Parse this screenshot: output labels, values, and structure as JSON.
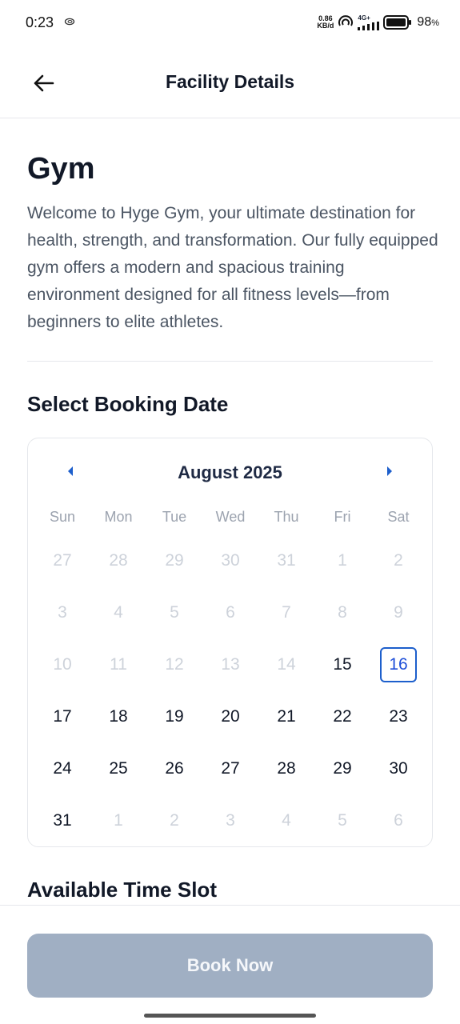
{
  "status_bar": {
    "time": "0:23",
    "net_speed_value": "0.86",
    "net_speed_unit": "KB/d",
    "network_type": "4G+",
    "battery_percent": "98",
    "battery_unit": "%"
  },
  "header": {
    "title": "Facility Details",
    "back_icon": "arrow-left-icon"
  },
  "facility": {
    "name": "Gym",
    "description": "Welcome to Hyge Gym, your ultimate destination for health, strength, and transformation. Our fully equipped gym offers a modern and spacious training environment designed for all fitness levels—from beginners to elite athletes."
  },
  "booking": {
    "section_title": "Select Booking Date",
    "calendar": {
      "month_label": "August 2025",
      "prev_icon": "caret-left-icon",
      "next_icon": "caret-right-icon",
      "weekdays": [
        "Sun",
        "Mon",
        "Tue",
        "Wed",
        "Thu",
        "Fri",
        "Sat"
      ],
      "days": [
        {
          "label": "27",
          "state": "muted"
        },
        {
          "label": "28",
          "state": "muted"
        },
        {
          "label": "29",
          "state": "muted"
        },
        {
          "label": "30",
          "state": "muted"
        },
        {
          "label": "31",
          "state": "muted"
        },
        {
          "label": "1",
          "state": "muted"
        },
        {
          "label": "2",
          "state": "muted"
        },
        {
          "label": "3",
          "state": "muted"
        },
        {
          "label": "4",
          "state": "muted"
        },
        {
          "label": "5",
          "state": "muted"
        },
        {
          "label": "6",
          "state": "muted"
        },
        {
          "label": "7",
          "state": "muted"
        },
        {
          "label": "8",
          "state": "muted"
        },
        {
          "label": "9",
          "state": "muted"
        },
        {
          "label": "10",
          "state": "muted"
        },
        {
          "label": "11",
          "state": "muted"
        },
        {
          "label": "12",
          "state": "muted"
        },
        {
          "label": "13",
          "state": "muted"
        },
        {
          "label": "14",
          "state": "muted"
        },
        {
          "label": "15",
          "state": "active"
        },
        {
          "label": "16",
          "state": "selected"
        },
        {
          "label": "17",
          "state": "active"
        },
        {
          "label": "18",
          "state": "active"
        },
        {
          "label": "19",
          "state": "active"
        },
        {
          "label": "20",
          "state": "active"
        },
        {
          "label": "21",
          "state": "active"
        },
        {
          "label": "22",
          "state": "active"
        },
        {
          "label": "23",
          "state": "active"
        },
        {
          "label": "24",
          "state": "active"
        },
        {
          "label": "25",
          "state": "active"
        },
        {
          "label": "26",
          "state": "active"
        },
        {
          "label": "27",
          "state": "active"
        },
        {
          "label": "28",
          "state": "active"
        },
        {
          "label": "29",
          "state": "active"
        },
        {
          "label": "30",
          "state": "active"
        },
        {
          "label": "31",
          "state": "active"
        },
        {
          "label": "1",
          "state": "muted"
        },
        {
          "label": "2",
          "state": "muted"
        },
        {
          "label": "3",
          "state": "muted"
        },
        {
          "label": "4",
          "state": "muted"
        },
        {
          "label": "5",
          "state": "muted"
        },
        {
          "label": "6",
          "state": "muted"
        }
      ]
    }
  },
  "time_slot": {
    "section_title": "Available Time Slot"
  },
  "footer": {
    "book_button_label": "Book Now"
  },
  "colors": {
    "accent": "#1d5fcc",
    "button_disabled": "#a0afc3",
    "muted_text": "#cdd2da"
  }
}
